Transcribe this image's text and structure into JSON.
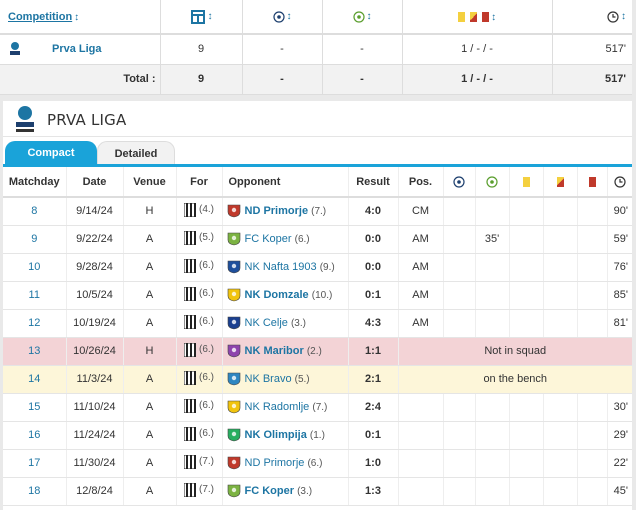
{
  "summary": {
    "headers": {
      "competition": "Competition",
      "sort_arrow": "↕"
    },
    "row": {
      "league": "Prva Liga",
      "apps": "9",
      "goals": "-",
      "assists": "-",
      "cards": "1 / - / -",
      "minutes": "517'"
    },
    "total": {
      "label": "Total :",
      "apps": "9",
      "goals": "-",
      "assists": "-",
      "cards": "1 / - / -",
      "minutes": "517'"
    }
  },
  "section": {
    "title": "PRVA LIGA",
    "tabs": [
      "Compact",
      "Detailed"
    ]
  },
  "table": {
    "headers": [
      "Matchday",
      "Date",
      "Venue",
      "For",
      "Opponent",
      "Result",
      "Pos."
    ],
    "rows": [
      {
        "matchday": "8",
        "date": "9/14/24",
        "venue": "H",
        "for_rank": "(4.)",
        "opponent": "ND Primorje",
        "opp_rank": "(7.)",
        "opp_bold": true,
        "crest": "#c0392b",
        "result": "4:0",
        "res_class": "win",
        "pos": "CM",
        "note": "",
        "goal_min": "",
        "minutes": "90'",
        "style": ""
      },
      {
        "matchday": "9",
        "date": "9/22/24",
        "venue": "A",
        "for_rank": "(5.)",
        "opponent": "FC Koper",
        "opp_rank": "(6.)",
        "opp_bold": false,
        "crest": "#7cb342",
        "result": "0:0",
        "res_class": "draw",
        "pos": "AM",
        "note": "",
        "goal_min": "35'",
        "minutes": "59'",
        "style": ""
      },
      {
        "matchday": "10",
        "date": "9/28/24",
        "venue": "A",
        "for_rank": "(6.)",
        "opponent": "NK Nafta 1903",
        "opp_rank": "(9.)",
        "opp_bold": false,
        "crest": "#1e4f9c",
        "result": "0:0",
        "res_class": "draw",
        "pos": "AM",
        "note": "",
        "goal_min": "",
        "minutes": "76'",
        "style": ""
      },
      {
        "matchday": "11",
        "date": "10/5/24",
        "venue": "A",
        "for_rank": "(6.)",
        "opponent": "NK Domzale",
        "opp_rank": "(10.)",
        "opp_bold": true,
        "crest": "#f1c40f",
        "result": "0:1",
        "res_class": "loss",
        "pos": "AM",
        "note": "",
        "goal_min": "",
        "minutes": "85'",
        "style": ""
      },
      {
        "matchday": "12",
        "date": "10/19/24",
        "venue": "A",
        "for_rank": "(6.)",
        "opponent": "NK Celje",
        "opp_rank": "(3.)",
        "opp_bold": false,
        "crest": "#1a3f8f",
        "result": "4:3",
        "res_class": "loss",
        "pos": "AM",
        "note": "",
        "goal_min": "",
        "minutes": "81'",
        "style": ""
      },
      {
        "matchday": "13",
        "date": "10/26/24",
        "venue": "H",
        "for_rank": "(6.)",
        "opponent": "NK Maribor",
        "opp_rank": "(2.)",
        "opp_bold": true,
        "crest": "#8e44ad",
        "result": "1:1",
        "res_class": "draw",
        "pos": "",
        "note": "Not in squad",
        "goal_min": "",
        "minutes": "",
        "style": "red"
      },
      {
        "matchday": "14",
        "date": "11/3/24",
        "venue": "A",
        "for_rank": "(6.)",
        "opponent": "NK Bravo",
        "opp_rank": "(5.)",
        "opp_bold": false,
        "crest": "#2e86c1",
        "result": "2:1",
        "res_class": "loss",
        "pos": "",
        "note": "on the bench",
        "goal_min": "",
        "minutes": "",
        "style": "yel"
      },
      {
        "matchday": "15",
        "date": "11/10/24",
        "venue": "A",
        "for_rank": "(6.)",
        "opponent": "NK Radomlje",
        "opp_rank": "(7.)",
        "opp_bold": false,
        "crest": "#f1c40f",
        "result": "2:4",
        "res_class": "win",
        "pos": "",
        "note": "",
        "goal_min": "",
        "minutes": "30'",
        "style": ""
      },
      {
        "matchday": "16",
        "date": "11/24/24",
        "venue": "A",
        "for_rank": "(6.)",
        "opponent": "NK Olimpija",
        "opp_rank": "(1.)",
        "opp_bold": true,
        "crest": "#27ae60",
        "result": "0:1",
        "res_class": "loss",
        "pos": "",
        "note": "",
        "goal_min": "",
        "minutes": "29'",
        "style": ""
      },
      {
        "matchday": "17",
        "date": "11/30/24",
        "venue": "A",
        "for_rank": "(7.)",
        "opponent": "ND Primorje",
        "opp_rank": "(6.)",
        "opp_bold": false,
        "crest": "#c0392b",
        "result": "1:0",
        "res_class": "loss",
        "pos": "",
        "note": "",
        "goal_min": "",
        "minutes": "22'",
        "style": ""
      },
      {
        "matchday": "18",
        "date": "12/8/24",
        "venue": "A",
        "for_rank": "(7.)",
        "opponent": "FC Koper",
        "opp_rank": "(3.)",
        "opp_bold": true,
        "crest": "#7cb342",
        "result": "1:3",
        "res_class": "loss",
        "pos": "",
        "note": "",
        "goal_min": "",
        "minutes": "45'",
        "style": ""
      }
    ]
  }
}
